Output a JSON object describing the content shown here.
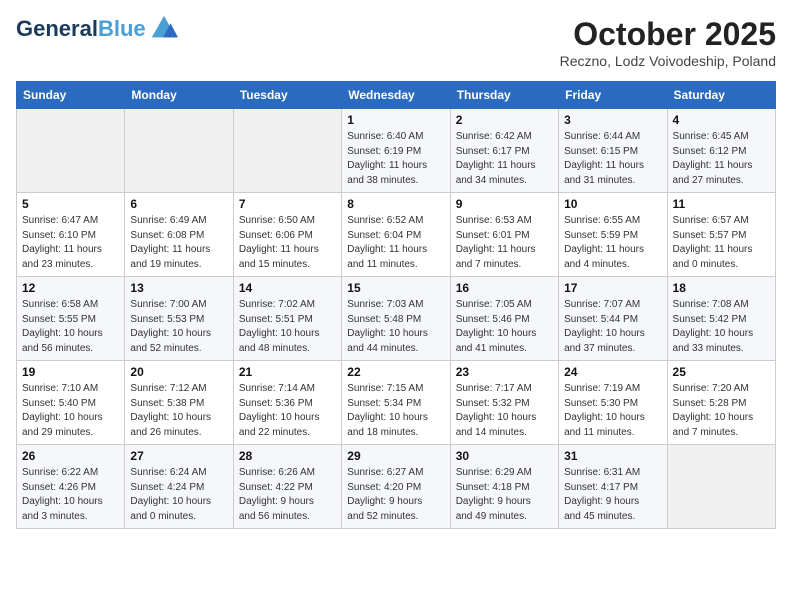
{
  "header": {
    "logo_line1": "General",
    "logo_line2": "Blue",
    "month": "October 2025",
    "location": "Reczno, Lodz Voivodeship, Poland"
  },
  "weekdays": [
    "Sunday",
    "Monday",
    "Tuesday",
    "Wednesday",
    "Thursday",
    "Friday",
    "Saturday"
  ],
  "weeks": [
    [
      {
        "day": "",
        "info": ""
      },
      {
        "day": "",
        "info": ""
      },
      {
        "day": "",
        "info": ""
      },
      {
        "day": "1",
        "info": "Sunrise: 6:40 AM\nSunset: 6:19 PM\nDaylight: 11 hours\nand 38 minutes."
      },
      {
        "day": "2",
        "info": "Sunrise: 6:42 AM\nSunset: 6:17 PM\nDaylight: 11 hours\nand 34 minutes."
      },
      {
        "day": "3",
        "info": "Sunrise: 6:44 AM\nSunset: 6:15 PM\nDaylight: 11 hours\nand 31 minutes."
      },
      {
        "day": "4",
        "info": "Sunrise: 6:45 AM\nSunset: 6:12 PM\nDaylight: 11 hours\nand 27 minutes."
      }
    ],
    [
      {
        "day": "5",
        "info": "Sunrise: 6:47 AM\nSunset: 6:10 PM\nDaylight: 11 hours\nand 23 minutes."
      },
      {
        "day": "6",
        "info": "Sunrise: 6:49 AM\nSunset: 6:08 PM\nDaylight: 11 hours\nand 19 minutes."
      },
      {
        "day": "7",
        "info": "Sunrise: 6:50 AM\nSunset: 6:06 PM\nDaylight: 11 hours\nand 15 minutes."
      },
      {
        "day": "8",
        "info": "Sunrise: 6:52 AM\nSunset: 6:04 PM\nDaylight: 11 hours\nand 11 minutes."
      },
      {
        "day": "9",
        "info": "Sunrise: 6:53 AM\nSunset: 6:01 PM\nDaylight: 11 hours\nand 7 minutes."
      },
      {
        "day": "10",
        "info": "Sunrise: 6:55 AM\nSunset: 5:59 PM\nDaylight: 11 hours\nand 4 minutes."
      },
      {
        "day": "11",
        "info": "Sunrise: 6:57 AM\nSunset: 5:57 PM\nDaylight: 11 hours\nand 0 minutes."
      }
    ],
    [
      {
        "day": "12",
        "info": "Sunrise: 6:58 AM\nSunset: 5:55 PM\nDaylight: 10 hours\nand 56 minutes."
      },
      {
        "day": "13",
        "info": "Sunrise: 7:00 AM\nSunset: 5:53 PM\nDaylight: 10 hours\nand 52 minutes."
      },
      {
        "day": "14",
        "info": "Sunrise: 7:02 AM\nSunset: 5:51 PM\nDaylight: 10 hours\nand 48 minutes."
      },
      {
        "day": "15",
        "info": "Sunrise: 7:03 AM\nSunset: 5:48 PM\nDaylight: 10 hours\nand 44 minutes."
      },
      {
        "day": "16",
        "info": "Sunrise: 7:05 AM\nSunset: 5:46 PM\nDaylight: 10 hours\nand 41 minutes."
      },
      {
        "day": "17",
        "info": "Sunrise: 7:07 AM\nSunset: 5:44 PM\nDaylight: 10 hours\nand 37 minutes."
      },
      {
        "day": "18",
        "info": "Sunrise: 7:08 AM\nSunset: 5:42 PM\nDaylight: 10 hours\nand 33 minutes."
      }
    ],
    [
      {
        "day": "19",
        "info": "Sunrise: 7:10 AM\nSunset: 5:40 PM\nDaylight: 10 hours\nand 29 minutes."
      },
      {
        "day": "20",
        "info": "Sunrise: 7:12 AM\nSunset: 5:38 PM\nDaylight: 10 hours\nand 26 minutes."
      },
      {
        "day": "21",
        "info": "Sunrise: 7:14 AM\nSunset: 5:36 PM\nDaylight: 10 hours\nand 22 minutes."
      },
      {
        "day": "22",
        "info": "Sunrise: 7:15 AM\nSunset: 5:34 PM\nDaylight: 10 hours\nand 18 minutes."
      },
      {
        "day": "23",
        "info": "Sunrise: 7:17 AM\nSunset: 5:32 PM\nDaylight: 10 hours\nand 14 minutes."
      },
      {
        "day": "24",
        "info": "Sunrise: 7:19 AM\nSunset: 5:30 PM\nDaylight: 10 hours\nand 11 minutes."
      },
      {
        "day": "25",
        "info": "Sunrise: 7:20 AM\nSunset: 5:28 PM\nDaylight: 10 hours\nand 7 minutes."
      }
    ],
    [
      {
        "day": "26",
        "info": "Sunrise: 6:22 AM\nSunset: 4:26 PM\nDaylight: 10 hours\nand 3 minutes."
      },
      {
        "day": "27",
        "info": "Sunrise: 6:24 AM\nSunset: 4:24 PM\nDaylight: 10 hours\nand 0 minutes."
      },
      {
        "day": "28",
        "info": "Sunrise: 6:26 AM\nSunset: 4:22 PM\nDaylight: 9 hours\nand 56 minutes."
      },
      {
        "day": "29",
        "info": "Sunrise: 6:27 AM\nSunset: 4:20 PM\nDaylight: 9 hours\nand 52 minutes."
      },
      {
        "day": "30",
        "info": "Sunrise: 6:29 AM\nSunset: 4:18 PM\nDaylight: 9 hours\nand 49 minutes."
      },
      {
        "day": "31",
        "info": "Sunrise: 6:31 AM\nSunset: 4:17 PM\nDaylight: 9 hours\nand 45 minutes."
      },
      {
        "day": "",
        "info": ""
      }
    ]
  ]
}
